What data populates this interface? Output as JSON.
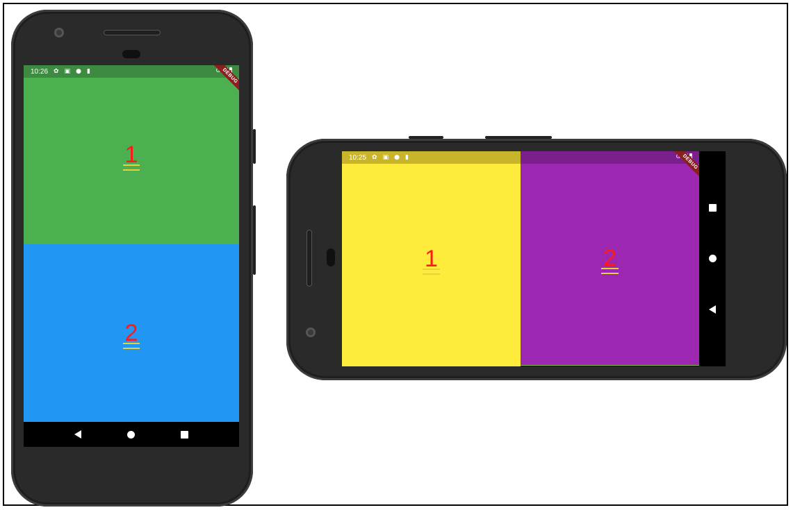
{
  "portrait": {
    "status": {
      "time": "10:26",
      "network": "G"
    },
    "debug_banner": "DEBUG",
    "panes": [
      {
        "label": "1",
        "color": "#4caf50"
      },
      {
        "label": "2",
        "color": "#2196f3"
      }
    ],
    "status_bar_color": "#3d8b40",
    "nav": {
      "back": "back-icon",
      "home": "home-icon",
      "recents": "recents-icon"
    }
  },
  "landscape": {
    "status": {
      "time": "10:25",
      "network": "G"
    },
    "debug_banner": "DEBUG",
    "panes": [
      {
        "label": "1",
        "color": "#ffeb3b"
      },
      {
        "label": "2",
        "color": "#9c27b0"
      }
    ],
    "status_bar_colors": [
      "#c8b52c",
      "#7b1f8c"
    ],
    "nav": {
      "recents": "recents-icon",
      "home": "home-icon",
      "back": "back-icon"
    }
  }
}
